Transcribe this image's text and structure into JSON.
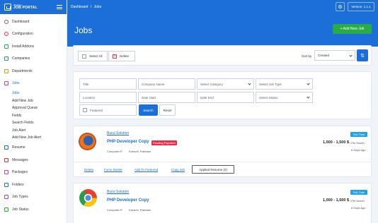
{
  "app": {
    "logo_title": "JOB PORTAL",
    "logo_sub": "Website"
  },
  "topbar": {
    "breadcrumb_home": "Dashboard",
    "breadcrumb_sep": "/",
    "breadcrumb_current": "Jobs",
    "version": "Version: 1.1.1"
  },
  "sidebar": {
    "items": [
      {
        "label": "Dashboard",
        "icon": "dashboard-icon"
      },
      {
        "label": "Configuration",
        "icon": "config-icon"
      },
      {
        "label": "Install Addons",
        "icon": "addons-icon"
      },
      {
        "label": "Companies",
        "icon": "companies-icon"
      },
      {
        "label": "Departments",
        "icon": "departments-icon"
      },
      {
        "label": "Jobs",
        "icon": "jobs-icon"
      }
    ],
    "subitems": [
      "Jobs",
      "Add New Job",
      "Approval Queue",
      "Fields",
      "Search Fields",
      "Job Alert",
      "Add New Job Alert"
    ],
    "bottom_items": [
      {
        "label": "Resume",
        "icon": "resume-icon"
      },
      {
        "label": "Messages",
        "icon": "messages-icon"
      },
      {
        "label": "Packages",
        "icon": "packages-icon"
      },
      {
        "label": "Folders",
        "icon": "folders-icon"
      },
      {
        "label": "Job Types",
        "icon": "jobtypes-icon"
      },
      {
        "label": "Job Status",
        "icon": "jobstatus-icon"
      }
    ]
  },
  "page": {
    "title": "Jobs",
    "add_button": "+  Add New Job"
  },
  "toolbar": {
    "select_all": "Select All",
    "delete": "Delete",
    "sort_by_label": "Sort by",
    "sort_value": "Created"
  },
  "filters": {
    "title": "Title",
    "company": "Company Name",
    "category": "Select Category",
    "job_type": "Select Job Type",
    "location": "Location",
    "date_start": "Date Start",
    "date_end": "Date End",
    "status": "Select Status",
    "featured": "Featured",
    "search": "Search",
    "reset": "Reset"
  },
  "jobs": [
    {
      "company": "Burui Solution",
      "title": "PHP Developer Copy",
      "pending": "Pending Payment",
      "category": "Computer/IT",
      "location": "Karachi, Pakistan",
      "type": "Full-Time",
      "salary": "1,000 - 1,500 $",
      "salary_period": "/ Per Month",
      "age": "6 Days Ago",
      "actions": [
        "Delete",
        "Force Delete",
        "Add To Featured",
        "Copy Job",
        "Applied Resume (0)"
      ]
    },
    {
      "company": "Burui Solution",
      "title": "PHP Developer Copy",
      "category": "Computer/IT",
      "location": "Karachi, Pakistan",
      "type": "Full-Time",
      "salary": "1,000 - 1,500 $",
      "salary_period": "/ Per Month",
      "age": "6 Days Ago"
    }
  ],
  "colors": {
    "primary": "#1c6fd9",
    "success": "#2aab45",
    "danger": "#e1344a",
    "badge": "#1fa3e8"
  }
}
